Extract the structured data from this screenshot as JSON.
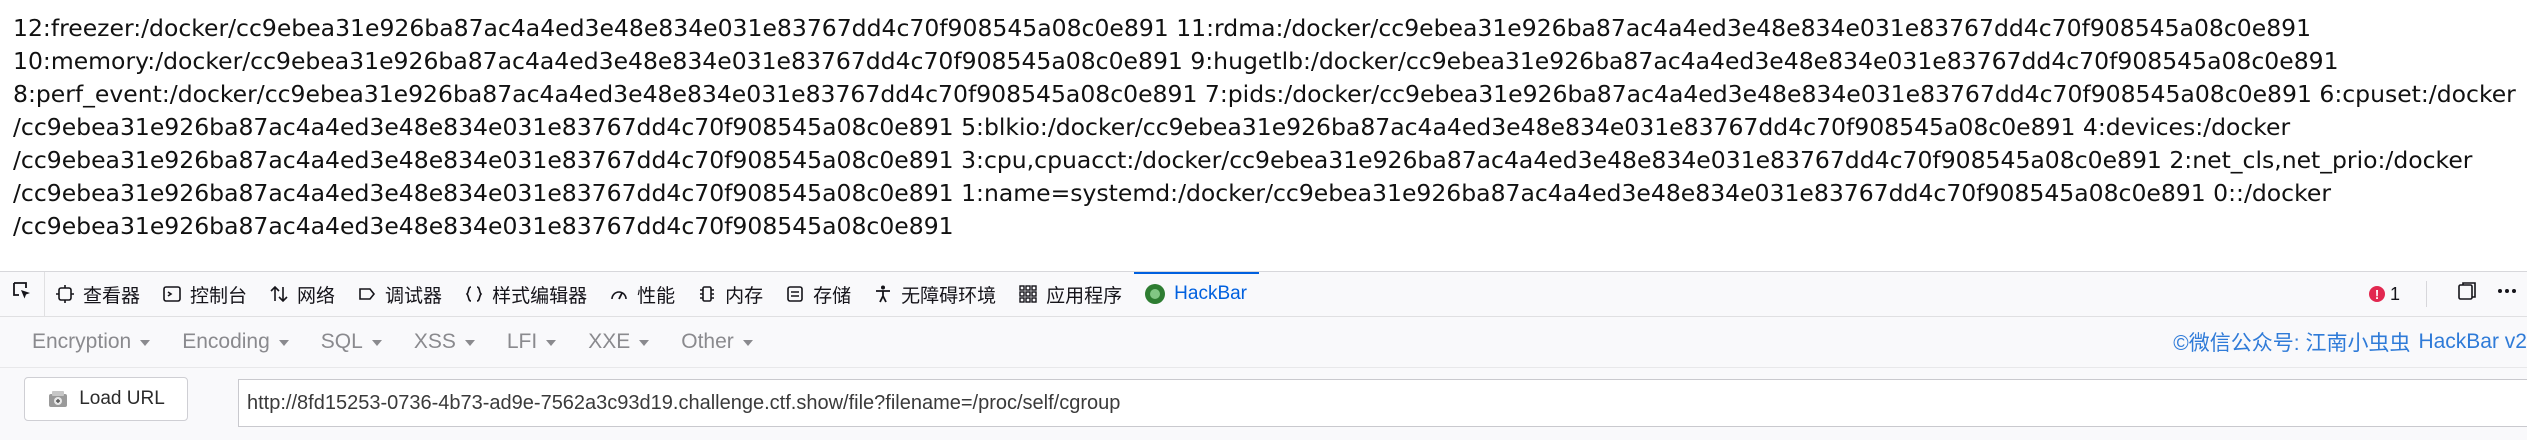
{
  "page_output": {
    "lines": [
      "12:freezer:/docker/cc9ebea31e926ba87ac4a4ed3e48e834e031e83767dd4c70f908545a08c0e891 11:rdma:/docker/cc9ebea31e926ba87ac4a4ed3e48e834e031e83767dd4c70f908545a08c0e891",
      "10:memory:/docker/cc9ebea31e926ba87ac4a4ed3e48e834e031e83767dd4c70f908545a08c0e891 9:hugetlb:/docker/cc9ebea31e926ba87ac4a4ed3e48e834e031e83767dd4c70f908545a08c0e891",
      "8:perf_event:/docker/cc9ebea31e926ba87ac4a4ed3e48e834e031e83767dd4c70f908545a08c0e891 7:pids:/docker/cc9ebea31e926ba87ac4a4ed3e48e834e031e83767dd4c70f908545a08c0e891 6:cpuset:/docker",
      "/cc9ebea31e926ba87ac4a4ed3e48e834e031e83767dd4c70f908545a08c0e891 5:blkio:/docker/cc9ebea31e926ba87ac4a4ed3e48e834e031e83767dd4c70f908545a08c0e891 4:devices:/docker",
      "/cc9ebea31e926ba87ac4a4ed3e48e834e031e83767dd4c70f908545a08c0e891 3:cpu,cpuacct:/docker/cc9ebea31e926ba87ac4a4ed3e48e834e031e83767dd4c70f908545a08c0e891 2:net_cls,net_prio:/docker",
      "/cc9ebea31e926ba87ac4a4ed3e48e834e031e83767dd4c70f908545a08c0e891 1:name=systemd:/docker/cc9ebea31e926ba87ac4a4ed3e48e834e031e83767dd4c70f908545a08c0e891 0::/docker",
      "/cc9ebea31e926ba87ac4a4ed3e48e834e031e83767dd4c70f908545a08c0e891"
    ]
  },
  "devtools": {
    "tabs": [
      {
        "label": "查看器",
        "icon": "inspector-icon"
      },
      {
        "label": "控制台",
        "icon": "console-icon"
      },
      {
        "label": "网络",
        "icon": "network-icon"
      },
      {
        "label": "调试器",
        "icon": "debugger-icon"
      },
      {
        "label": "样式编辑器",
        "icon": "style-editor-icon"
      },
      {
        "label": "性能",
        "icon": "performance-icon"
      },
      {
        "label": "内存",
        "icon": "memory-icon"
      },
      {
        "label": "存储",
        "icon": "storage-icon"
      },
      {
        "label": "无障碍环境",
        "icon": "accessibility-icon"
      },
      {
        "label": "应用程序",
        "icon": "application-icon"
      },
      {
        "label": "HackBar",
        "icon": "hackbar-icon",
        "active": true
      }
    ],
    "error_count": "1",
    "colors": {
      "accent": "#0060df",
      "error": "#e22850",
      "credit": "#2f7bd8"
    }
  },
  "hackbar": {
    "menu": [
      "Encryption",
      "Encoding",
      "SQL",
      "XSS",
      "LFI",
      "XXE",
      "Other"
    ],
    "credit_cn": "©微信公众号: 江南小虫虫",
    "credit_en": "HackBar v2",
    "load_url_label": "Load URL",
    "url_value": "http://8fd15253-0736-4b73-ad9e-7562a3c93d19.challenge.ctf.show/file?filename=/proc/self/cgroup"
  }
}
